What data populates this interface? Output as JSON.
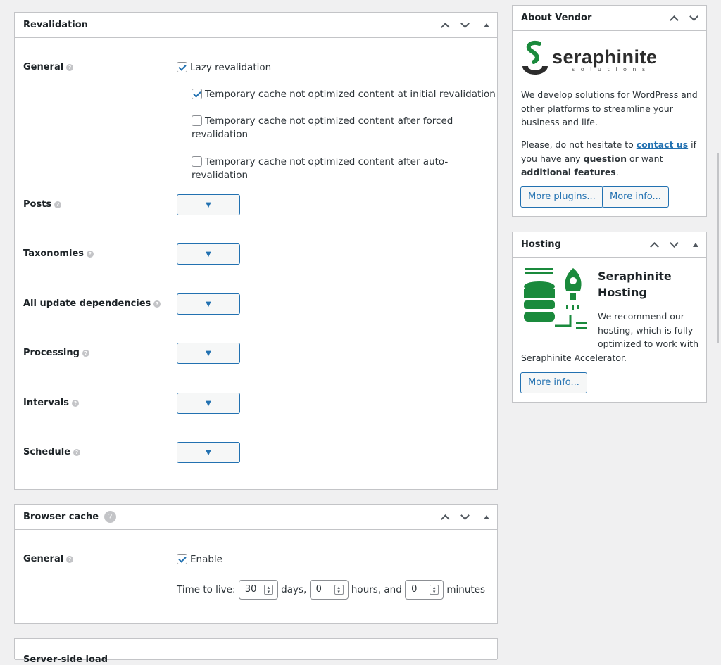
{
  "revalidation": {
    "title": "Revalidation",
    "general_label": "General",
    "lazy": "Lazy revalidation",
    "opt_initial": "Temporary cache not optimized content at initial revalidation",
    "opt_forced_1": "Temporary cache not optimized content after forced",
    "opt_forced_2": "revalidation",
    "opt_auto": "Temporary cache not optimized content after auto-revalidation",
    "rows": {
      "posts": "Posts",
      "taxonomies": "Taxonomies",
      "deps": "All update dependencies",
      "processing": "Processing",
      "intervals": "Intervals",
      "schedule": "Schedule"
    }
  },
  "browser_cache": {
    "title": "Browser cache",
    "general_label": "General",
    "enable": "Enable",
    "ttl_label": "Time to live:",
    "days": "30",
    "days_unit": "days,",
    "hours": "0",
    "hours_unit": "hours, and",
    "minutes": "0",
    "minutes_unit": "minutes"
  },
  "next_panel": {
    "title": "Server-side load"
  },
  "about": {
    "title": "About Vendor",
    "logo_name": "seraphinite",
    "logo_sub": "s o l u t i o n s",
    "p1": "We develop solutions for WordPress and other platforms to streamline your business and life.",
    "p2_a": "Please, do not hesitate to ",
    "p2_link": "contact us",
    "p2_b": " if you have any ",
    "p2_q": "question",
    "p2_c": " or want ",
    "p2_f": "additional features",
    "p2_d": ".",
    "btn_plugins": "More plugins...",
    "btn_info": "More info..."
  },
  "hosting": {
    "title": "Hosting",
    "heading_1": "Seraphinite",
    "heading_2": "Hosting",
    "text": "We recommend our hosting, which is fully optimized to work with Seraphinite Accelerator.",
    "btn_info": "More info..."
  },
  "colors": {
    "accent": "#2271b1",
    "brand_green": "#1a8a3c"
  }
}
